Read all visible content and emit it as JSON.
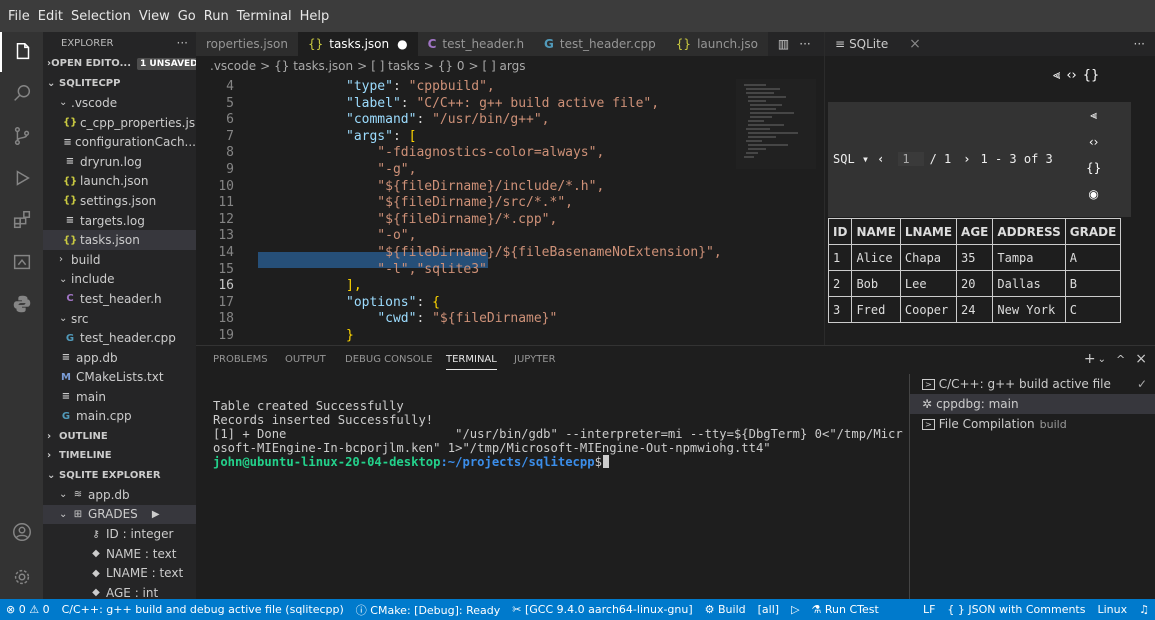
{
  "menu": [
    "File",
    "Edit",
    "Selection",
    "View",
    "Go",
    "Run",
    "Terminal",
    "Help"
  ],
  "sidebar": {
    "title": "EXPLORER",
    "more": "···",
    "open_editors": "OPEN EDITO...",
    "unsaved": "1 UNSAVED",
    "workspace": "SQLITECPP",
    "tree": [
      {
        "label": ".vscode",
        "type": "folder-open",
        "indent": 1
      },
      {
        "label": "c_cpp_properties.js...",
        "type": "json",
        "indent": 2
      },
      {
        "label": "configurationCach...",
        "type": "txt",
        "indent": 2
      },
      {
        "label": "dryrun.log",
        "type": "txt",
        "indent": 2
      },
      {
        "label": "launch.json",
        "type": "json",
        "indent": 2
      },
      {
        "label": "settings.json",
        "type": "json",
        "indent": 2
      },
      {
        "label": "targets.log",
        "type": "txt",
        "indent": 2
      },
      {
        "label": "tasks.json",
        "type": "json",
        "indent": 2,
        "selected": true
      },
      {
        "label": "build",
        "type": "folder",
        "indent": 1
      },
      {
        "label": "include",
        "type": "folder-open",
        "indent": 1
      },
      {
        "label": "test_header.h",
        "type": "h",
        "indent": 2
      },
      {
        "label": "src",
        "type": "folder-open",
        "indent": 1
      },
      {
        "label": "test_header.cpp",
        "type": "cpp",
        "indent": 2
      },
      {
        "label": "app.db",
        "type": "txt",
        "indent": 1
      },
      {
        "label": "CMakeLists.txt",
        "type": "cmake",
        "indent": 1
      },
      {
        "label": "main",
        "type": "txt",
        "indent": 1
      },
      {
        "label": "main.cpp",
        "type": "cpp",
        "indent": 1
      }
    ],
    "outline": "OUTLINE",
    "timeline": "TIMELINE",
    "sqlite_explorer": "SQLITE EXPLORER",
    "db": "app.db",
    "table": "GRADES",
    "columns": [
      "ID : integer",
      "NAME : text",
      "LNAME : text",
      "AGE : int"
    ]
  },
  "editor": {
    "tabs": [
      {
        "label": "roperties.json",
        "icon": "{}"
      },
      {
        "label": "tasks.json",
        "icon": "{}",
        "active": true,
        "dirty": "●"
      },
      {
        "label": "test_header.h",
        "icon": "C"
      },
      {
        "label": "test_header.cpp",
        "icon": "G"
      },
      {
        "label": "launch.jso",
        "icon": "{}"
      }
    ],
    "tab_actions": "···",
    "breadcrumb": [
      ".vscode",
      ">",
      "{} tasks.json",
      ">",
      "[ ] tasks",
      ">",
      "{} 0",
      ">",
      "[ ] args"
    ],
    "lines": [
      {
        "n": "4",
        "text": "\"type\": \"cppbuild\","
      },
      {
        "n": "5",
        "text": "\"label\": \"C/C++: g++ build active file\","
      },
      {
        "n": "6",
        "text": "\"command\": \"/usr/bin/g++\","
      },
      {
        "n": "7",
        "text": "\"args\": ["
      },
      {
        "n": "8",
        "text": "    \"-fdiagnostics-color=always\","
      },
      {
        "n": "9",
        "text": "    \"-g\","
      },
      {
        "n": "10",
        "text": "    \"${fileDirname}/include/*.h\","
      },
      {
        "n": "11",
        "text": "    \"${fileDirname}/src/*.*\","
      },
      {
        "n": "12",
        "text": "    \"${fileDirname}/*.cpp\","
      },
      {
        "n": "13",
        "text": "    \"-o\","
      },
      {
        "n": "14",
        "text": "    \"${fileDirname}/${fileBasenameNoExtension}\","
      },
      {
        "n": "15",
        "text": "    \"-l\",\"sqlite3\""
      },
      {
        "n": "16",
        "text": "],"
      },
      {
        "n": "17",
        "text": "\"options\": {"
      },
      {
        "n": "18",
        "text": "    \"cwd\": \"${fileDirname}\""
      },
      {
        "n": "19",
        "text": "}"
      }
    ]
  },
  "sqlite": {
    "tab": "SQLite",
    "close": "×",
    "more": "···",
    "mode": "SQL ▾",
    "page": "1",
    "of": "/ 1",
    "range": "1 - 3 of 3",
    "headers": [
      "ID",
      "NAME",
      "LNAME",
      "AGE",
      "ADDRESS",
      "GRADE"
    ],
    "rows": [
      [
        "1",
        "Alice",
        "Chapa",
        "35",
        "Tampa",
        "A"
      ],
      [
        "2",
        "Bob",
        "Lee",
        "20",
        "Dallas",
        "B"
      ],
      [
        "3",
        "Fred",
        "Cooper",
        "24",
        "New York",
        "C"
      ]
    ]
  },
  "panel": {
    "tabs": [
      "PROBLEMS",
      "OUTPUT",
      "DEBUG CONSOLE",
      "TERMINAL",
      "JUPYTER"
    ],
    "terminal_lines": [
      "Table created Successfully",
      "Records inserted Successfully!",
      "[1] + Done                       \"/usr/bin/gdb\" --interpreter=mi --tty=${DbgTerm} 0<\"/tmp/Micr",
      "osoft-MIEngine-In-bcporjlm.ken\" 1>\"/tmp/Microsoft-MIEngine-Out-npmwiohg.tt4\""
    ],
    "prompt_user": "john@ubuntu-linux-20-04-desktop",
    "prompt_path": ":~/projects/sqlitecpp",
    "prompt_end": "$",
    "terminals": [
      {
        "label": "C/C++: g++ build active file",
        "check": "✓"
      },
      {
        "label": "cppdbg: main"
      },
      {
        "label": "File Compilation",
        "sub": "build"
      }
    ]
  },
  "status": [
    "⊗ 0 ⚠ 0",
    "C/C++: g++ build and debug active file (sqlitecpp)",
    "ⓘ CMake: [Debug]: Ready",
    "✂ [GCC 9.4.0 aarch64-linux-gnu]",
    "⚙ Build",
    "[all]",
    "▷",
    "⚗ Run CTest",
    "LF",
    "{ } JSON with Comments",
    "Linux"
  ]
}
